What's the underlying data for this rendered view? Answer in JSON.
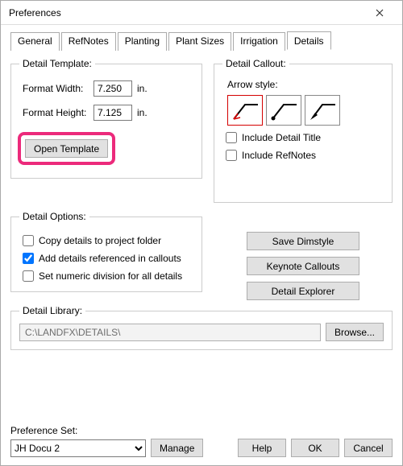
{
  "window": {
    "title": "Preferences"
  },
  "tabs": {
    "general": "General",
    "refnotes": "RefNotes",
    "planting": "Planting",
    "plantsizes": "Plant Sizes",
    "irrigation": "Irrigation",
    "details": "Details"
  },
  "template": {
    "legend": "Detail Template:",
    "width_label": "Format Width:",
    "width_value": "7.250",
    "height_label": "Format Height:",
    "height_value": "7.125",
    "unit": "in.",
    "open_btn": "Open Template"
  },
  "callout": {
    "legend": "Detail Callout:",
    "arrow_label": "Arrow style:",
    "include_title": "Include Detail Title",
    "include_refnotes": "Include RefNotes"
  },
  "options": {
    "legend": "Detail Options:",
    "copy": "Copy details to project folder",
    "add_ref": "Add details referenced in callouts",
    "numeric": "Set numeric division for all details"
  },
  "right_buttons": {
    "save_dim": "Save Dimstyle",
    "keynote": "Keynote Callouts",
    "explorer": "Detail Explorer"
  },
  "library": {
    "legend": "Detail Library:",
    "path": "C:\\LANDFX\\DETAILS\\",
    "browse": "Browse..."
  },
  "prefset": {
    "label": "Preference Set:",
    "value": "JH Docu 2",
    "manage": "Manage"
  },
  "buttons": {
    "help": "Help",
    "ok": "OK",
    "cancel": "Cancel"
  }
}
